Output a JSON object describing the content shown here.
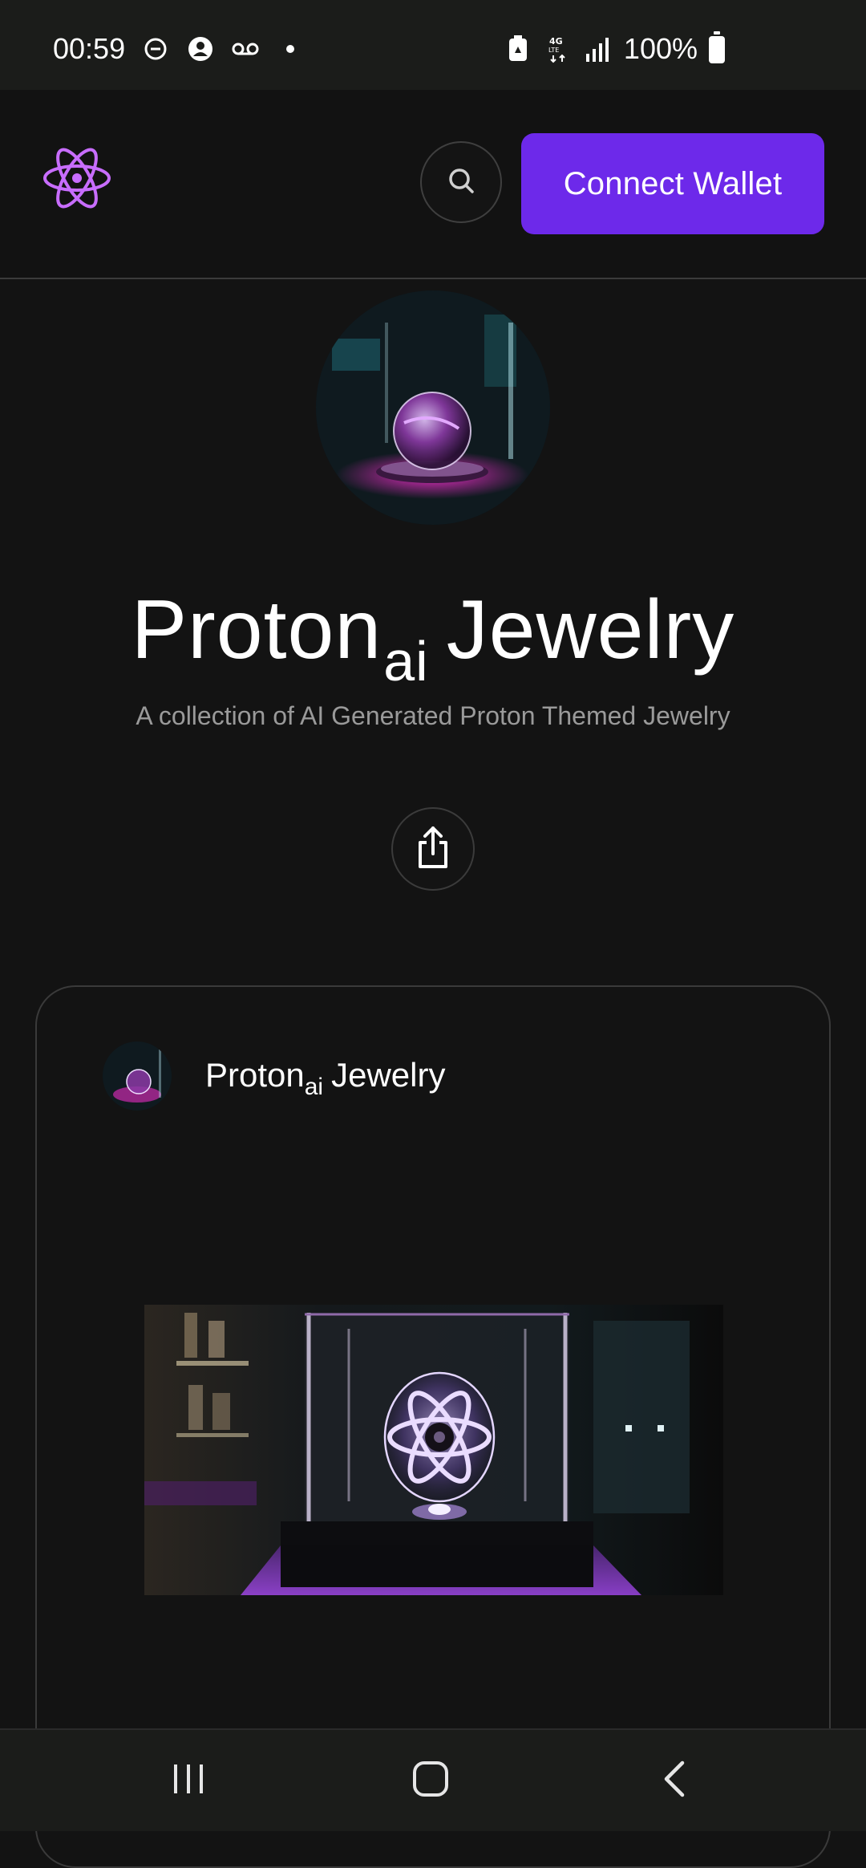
{
  "status_bar": {
    "time": "00:59",
    "icons": [
      "do-not-disturb-icon",
      "account-icon",
      "voicemail-icon",
      "dot-icon"
    ],
    "right_icons": [
      "battery-saver-icon",
      "4g-lte-icon",
      "signal-icon"
    ],
    "battery_percent": "100%"
  },
  "header": {
    "logo_icon": "atom-logo-icon",
    "search_icon": "search-icon",
    "connect_label": "Connect Wallet",
    "accent_color": "#6d29ea"
  },
  "profile": {
    "title_main": "Proton",
    "title_sub": "ai",
    "title_tail": "Jewelry",
    "description": "A collection of AI Generated Proton Themed Jewelry",
    "share_icon": "share-icon"
  },
  "card": {
    "name_main": "Proton",
    "name_sub": "ai",
    "name_tail": "Jewelry"
  },
  "navbar": {
    "recent_icon": "recent-apps-icon",
    "home_icon": "home-icon",
    "back_icon": "back-icon"
  }
}
